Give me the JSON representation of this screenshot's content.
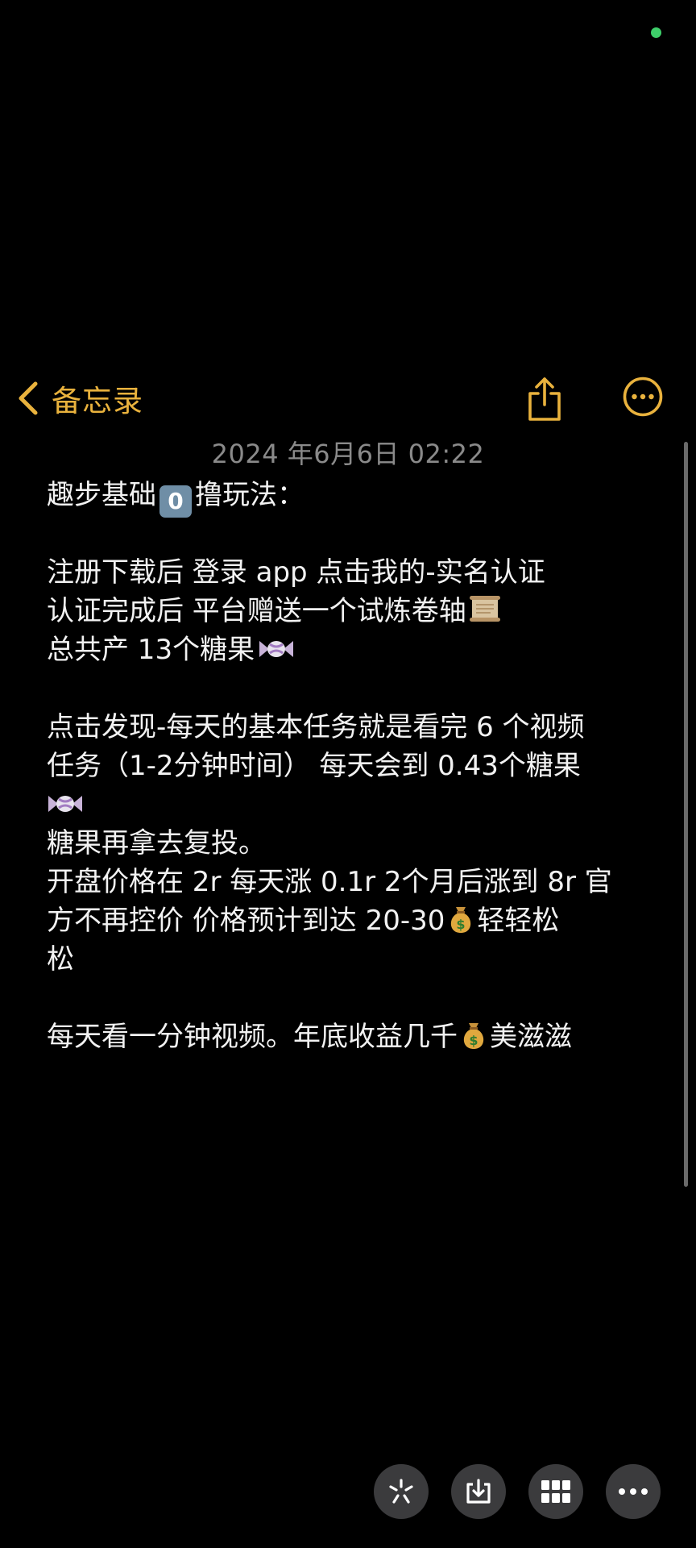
{
  "nav": {
    "back_label": "备忘录"
  },
  "note": {
    "date": "2024 年6月6日 02:22",
    "lines": {
      "l1_before": "趣步基础",
      "l1_keycap": "0",
      "l1_after": "撸玩法：",
      "l3": "注册下载后   登录 app 点击我的-实名认证",
      "l4": "认证完成后 平台赠送一个试炼卷轴",
      "l5": "总共产 13个糖果",
      "l7": "点击发现-每天的基本任务就是看完 6 个视频",
      "l8": "任务（1-2分钟时间）  每天会到 0.43个糖果",
      "l10": "糖果再拿去复投。",
      "l11": "开盘价格在 2r 每天涨 0.1r  2个月后涨到 8r 官",
      "l12_before": "方不再控价  价格预计到达 20-30",
      "l12_after": "轻轻松",
      "l13": "松",
      "l15_before": "每天看一分钟视频。年底收益几千",
      "l15_after": "美滋滋"
    }
  },
  "icons": {
    "back": "chevron-left-icon",
    "share": "share-icon",
    "more": "ellipsis-circle-icon",
    "scroll": "scroll-emoji-icon",
    "candy": "candy-emoji-icon",
    "money": "money-bag-emoji-icon",
    "toolbar": [
      "sparkle-icon",
      "download-icon",
      "grid-icon",
      "more-icon"
    ]
  },
  "colors": {
    "accent": "#e9b23d",
    "background": "#000000",
    "text": "#f2f2f2",
    "date_text": "#8a8a8a",
    "toolbar_button": "#3b3b3d",
    "status_dot": "#3ecf6a"
  }
}
